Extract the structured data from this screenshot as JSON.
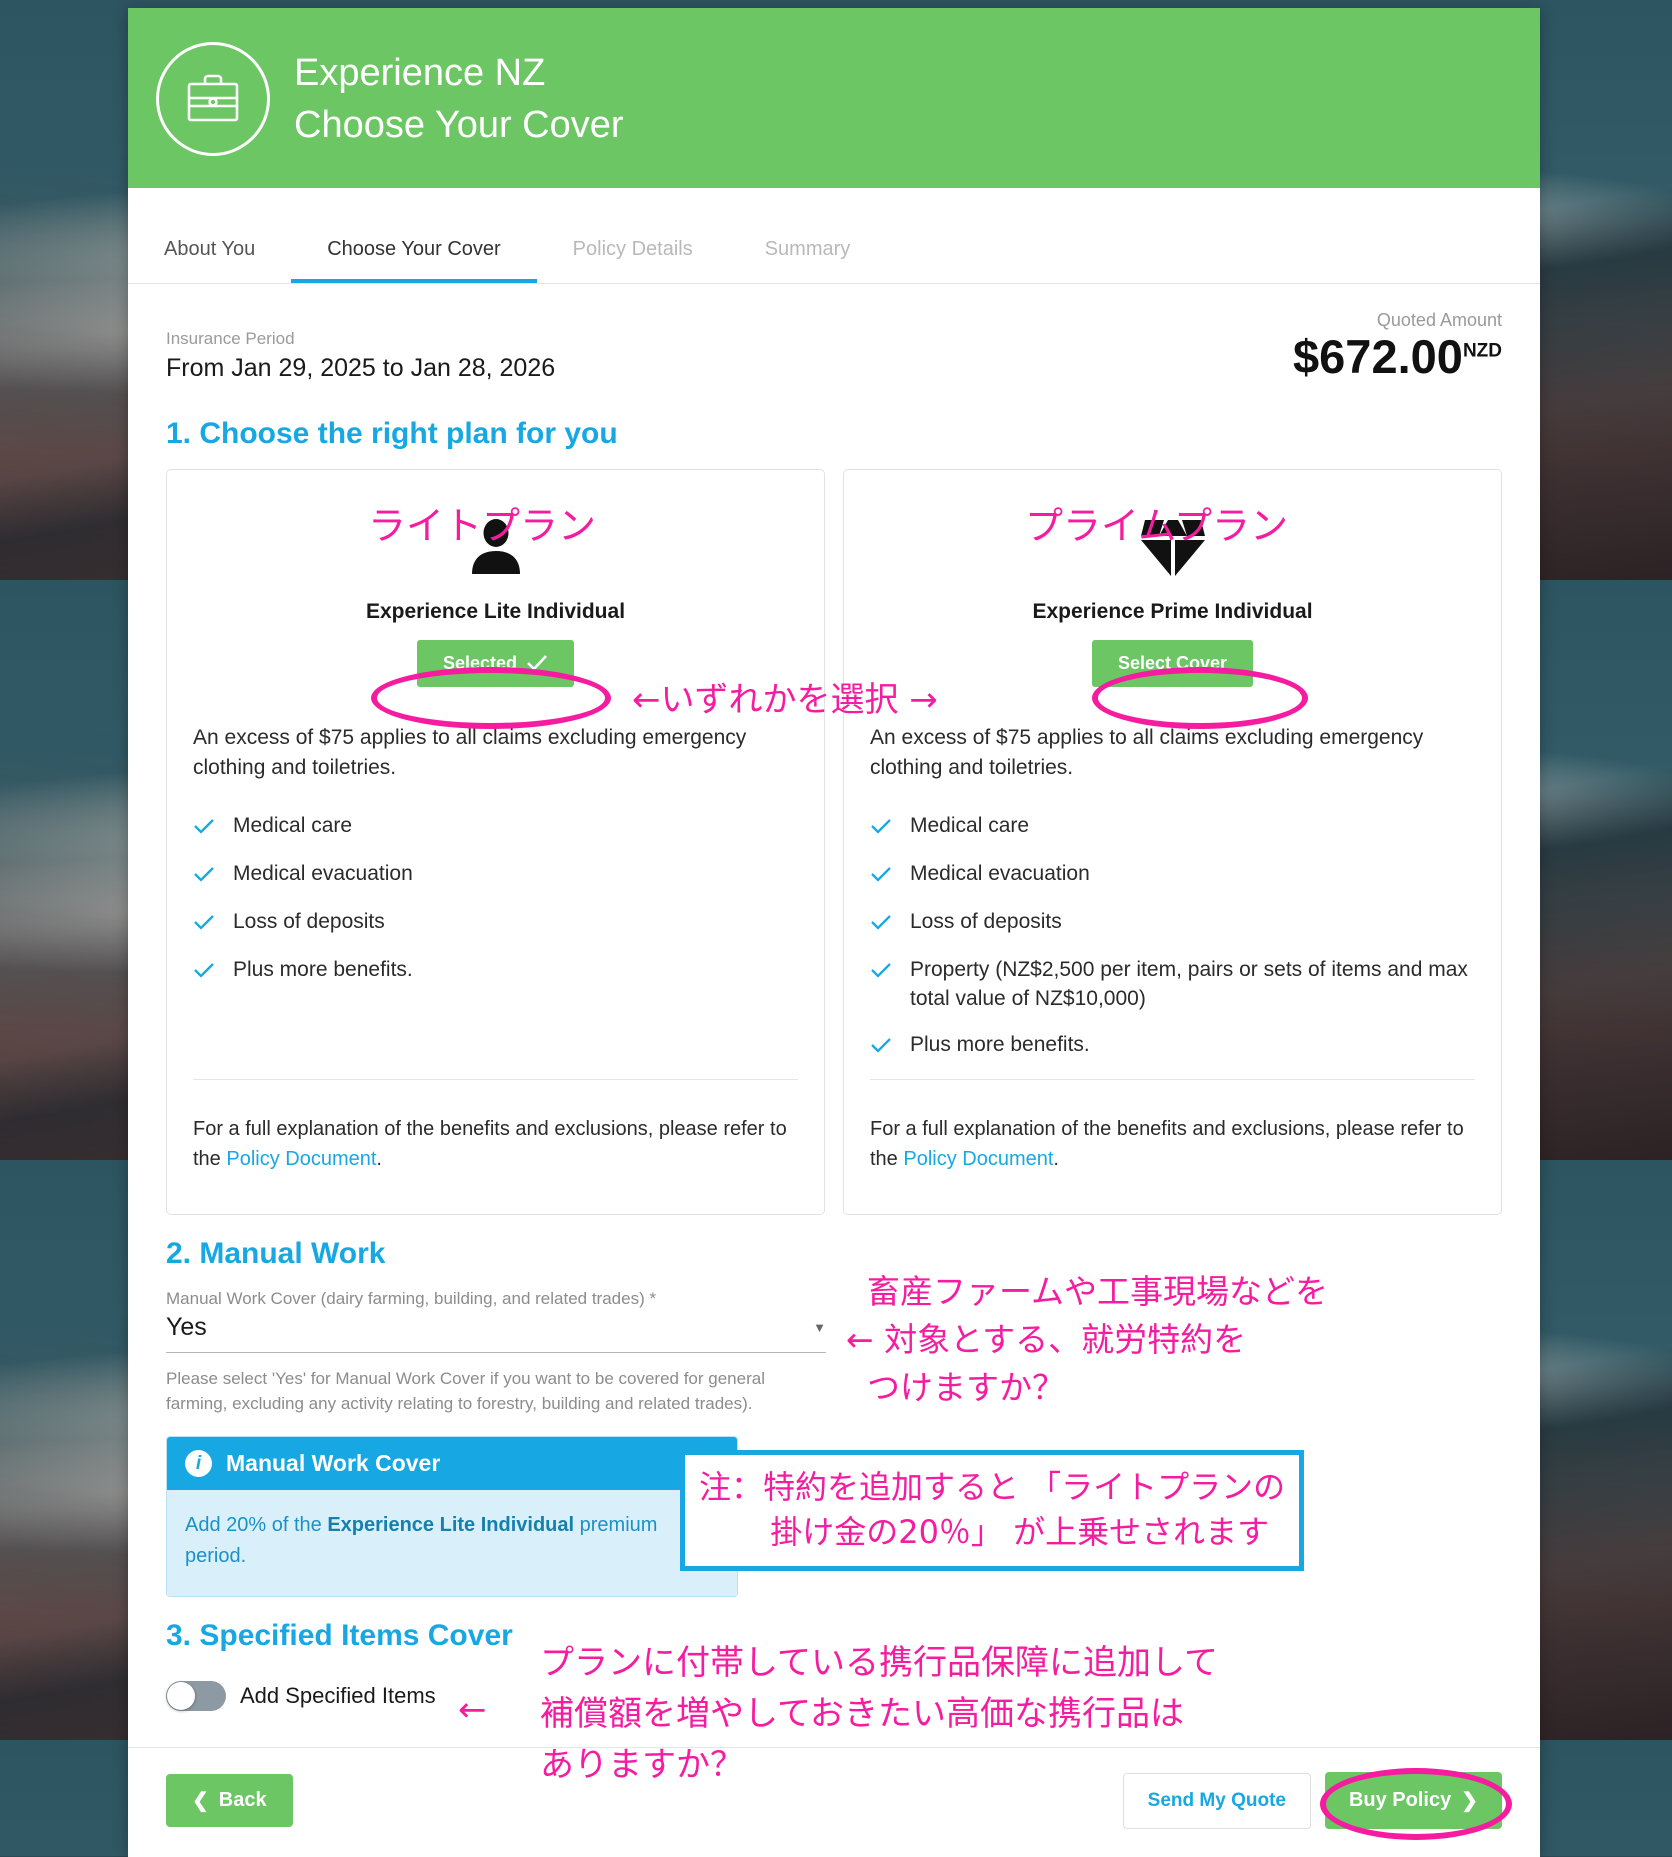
{
  "header": {
    "icon": "briefcase-icon",
    "title_line1": "Experience NZ",
    "title_line2": "Choose Your Cover",
    "bg_color": "#6cc664"
  },
  "tabs": [
    {
      "label": "About You",
      "state": "done"
    },
    {
      "label": "Choose Your Cover",
      "state": "active"
    },
    {
      "label": "Policy Details",
      "state": "disabled"
    },
    {
      "label": "Summary",
      "state": "disabled"
    }
  ],
  "quote": {
    "period_label": "Insurance Period",
    "period_value": "From Jan 29, 2025 to Jan 28, 2026",
    "amount_label": "Quoted Amount",
    "amount": "$672.00",
    "currency": "NZD"
  },
  "section1": {
    "title": "1. Choose the right plan for you",
    "plans": [
      {
        "icon": "person-icon",
        "name": "Experience Lite Individual",
        "button_label": "Selected",
        "selected": true,
        "excess": "An excess of $75 applies to all claims excluding emergency clothing and toiletries.",
        "benefits": [
          "Medical care",
          "Medical evacuation",
          "Loss of deposits",
          "Plus more benefits."
        ],
        "footer_prefix": "For a full explanation of the benefits and exclusions, please refer to the ",
        "footer_link": "Policy Document",
        "footer_suffix": "."
      },
      {
        "icon": "diamond-icon",
        "name": "Experience Prime Individual",
        "button_label": "Select Cover",
        "selected": false,
        "excess": "An excess of $75 applies to all claims excluding emergency clothing and toiletries.",
        "benefits": [
          "Medical care",
          "Medical evacuation",
          "Loss of deposits",
          "Property (NZ$2,500 per item, pairs or sets of items and max total value of NZ$10,000)",
          "Plus more benefits."
        ],
        "footer_prefix": "For a full explanation of the benefits and exclusions, please refer to the ",
        "footer_link": "Policy Document",
        "footer_suffix": "."
      }
    ]
  },
  "section2": {
    "title": "2. Manual Work",
    "field_label": "Manual Work Cover (dairy farming, building, and related trades) *",
    "field_value": "Yes",
    "hint": "Please select 'Yes' for Manual Work Cover if you want to be covered for general farming, excluding any activity relating to forestry, building and related trades).",
    "info_title": "Manual Work Cover",
    "info_body_part1": "Add 20% of the ",
    "info_body_bold": "Experience Lite Individual",
    "info_body_part2": " premium period."
  },
  "section3": {
    "title": "3. Specified Items Cover",
    "toggle_label": "Add Specified Items",
    "toggle_on": false
  },
  "footer": {
    "back_label": "Back",
    "send_quote_label": "Send My Quote",
    "buy_policy_label": "Buy Policy"
  },
  "annotations": {
    "lite_plan": "ライトプラン",
    "prime_plan": "プライムプラン",
    "choose_either": "←いずれかを選択 →",
    "manual_work_q_line1": "  畜産ファームや工事現場などを",
    "manual_work_q_line2": "← 対象とする、就労特約を",
    "manual_work_q_line3": "  つけますか？",
    "note_box_line1": "注：特約を追加すると 「ライトプランの",
    "note_box_line2": "       掛け金の20％」 が上乗せされます",
    "specified_q_line1": "プランに付帯している携行品保障に追加して",
    "specified_q_line2": "補償額を増やしておきたい高価な携行品は",
    "specified_q_line3": "ありますか？",
    "specified_arrow": "←",
    "color": "#f51ca0",
    "box_border_color": "#17a8e3"
  }
}
